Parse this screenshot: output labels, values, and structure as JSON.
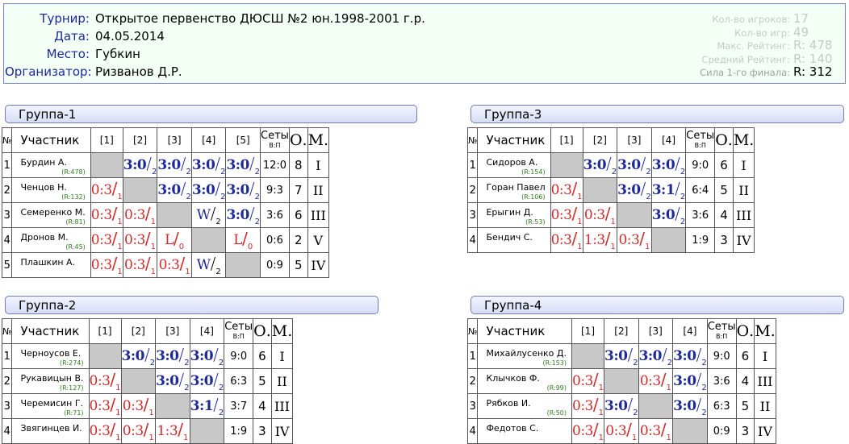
{
  "info": {
    "tournament_label": "Турнир:",
    "tournament": "Открытое первенство ДЮСШ №2 юн.1998-2001 г.р.",
    "date_label": "Дата:",
    "date": "04.05.2014",
    "place_label": "Место:",
    "place": "Губкин",
    "organizer_label": "Организатор:",
    "organizer": "Ризванов Д.Р.",
    "stats": [
      {
        "label": "Кол-во игроков:",
        "value": "17"
      },
      {
        "label": "Кол-во игр:",
        "value": "49"
      },
      {
        "label": "Макс. Рейтинг:",
        "value": "R: 478"
      },
      {
        "label": "Средний Рейтинг:",
        "value": "R: 140"
      },
      {
        "label": "Сила 1-го финала:",
        "value": "R: 312"
      }
    ]
  },
  "headers": {
    "num": "№",
    "name": "Участник",
    "sets": "Сеты",
    "sets_sub": "В:П",
    "points": "О.",
    "place": "М."
  },
  "groups": [
    {
      "title": "Группа-1",
      "cols": [
        "[1]",
        "[2]",
        "[3]",
        "[4]",
        "[5]"
      ],
      "rows": [
        {
          "n": "1",
          "name": "Бурдин А.",
          "rating": "(R:478)",
          "sets": "12:0",
          "pts": "8",
          "place": "I",
          "res": [
            null,
            {
              "s": "3:0",
              "p": "2",
              "t": "win"
            },
            {
              "s": "3:0",
              "p": "2",
              "t": "win"
            },
            {
              "s": "3:0",
              "p": "2",
              "t": "win"
            },
            {
              "s": "3:0",
              "p": "2",
              "t": "win"
            }
          ]
        },
        {
          "n": "2",
          "name": "Ченцов Н.",
          "rating": "(R:132)",
          "sets": "9:3",
          "pts": "7",
          "place": "II",
          "res": [
            {
              "s": "0:3",
              "p": "1",
              "t": "loss"
            },
            null,
            {
              "s": "3:0",
              "p": "2",
              "t": "win"
            },
            {
              "s": "3:0",
              "p": "2",
              "t": "win"
            },
            {
              "s": "3:0",
              "p": "2",
              "t": "win"
            }
          ]
        },
        {
          "n": "3",
          "name": "Семеренко М.",
          "rating": "(R:81)",
          "sets": "3:6",
          "pts": "6",
          "place": "III",
          "res": [
            {
              "s": "0:3",
              "p": "1",
              "t": "loss"
            },
            {
              "s": "0:3",
              "p": "1",
              "t": "loss"
            },
            null,
            {
              "s": "W",
              "p": "2",
              "t": "wo"
            },
            {
              "s": "3:0",
              "p": "2",
              "t": "win"
            }
          ]
        },
        {
          "n": "4",
          "name": "Дронов М.",
          "rating": "(R:45)",
          "sets": "0:6",
          "pts": "2",
          "place": "V",
          "res": [
            {
              "s": "0:3",
              "p": "1",
              "t": "loss"
            },
            {
              "s": "0:3",
              "p": "1",
              "t": "loss"
            },
            {
              "s": "L",
              "p": "0",
              "t": "lo"
            },
            null,
            {
              "s": "L",
              "p": "0",
              "t": "lo"
            }
          ]
        },
        {
          "n": "5",
          "name": "Плашкин А.",
          "rating": "",
          "sets": "0:9",
          "pts": "5",
          "place": "IV",
          "res": [
            {
              "s": "0:3",
              "p": "1",
              "t": "loss"
            },
            {
              "s": "0:3",
              "p": "1",
              "t": "loss"
            },
            {
              "s": "0:3",
              "p": "1",
              "t": "loss"
            },
            {
              "s": "W",
              "p": "2",
              "t": "wo"
            },
            null
          ]
        }
      ]
    },
    {
      "title": "Группа-2",
      "cols": [
        "[1]",
        "[2]",
        "[3]",
        "[4]"
      ],
      "rows": [
        {
          "n": "1",
          "name": "Черноусов Е.",
          "rating": "(R:274)",
          "sets": "9:0",
          "pts": "6",
          "place": "I",
          "res": [
            null,
            {
              "s": "3:0",
              "p": "2",
              "t": "win"
            },
            {
              "s": "3:0",
              "p": "2",
              "t": "win"
            },
            {
              "s": "3:0",
              "p": "2",
              "t": "win"
            }
          ]
        },
        {
          "n": "2",
          "name": "Рукавицын В.",
          "rating": "(R:127)",
          "sets": "6:3",
          "pts": "5",
          "place": "II",
          "res": [
            {
              "s": "0:3",
              "p": "1",
              "t": "loss"
            },
            null,
            {
              "s": "3:0",
              "p": "2",
              "t": "win"
            },
            {
              "s": "3:0",
              "p": "2",
              "t": "win"
            }
          ]
        },
        {
          "n": "3",
          "name": "Черемисин Г.",
          "rating": "(R:71)",
          "sets": "3:7",
          "pts": "4",
          "place": "III",
          "res": [
            {
              "s": "0:3",
              "p": "1",
              "t": "loss"
            },
            {
              "s": "0:3",
              "p": "1",
              "t": "loss"
            },
            null,
            {
              "s": "3:1",
              "p": "2",
              "t": "win"
            }
          ]
        },
        {
          "n": "4",
          "name": "Звягинцев И.",
          "rating": "",
          "sets": "1:9",
          "pts": "3",
          "place": "IV",
          "res": [
            {
              "s": "0:3",
              "p": "1",
              "t": "loss"
            },
            {
              "s": "0:3",
              "p": "1",
              "t": "loss"
            },
            {
              "s": "1:3",
              "p": "1",
              "t": "loss"
            },
            null
          ]
        }
      ]
    },
    {
      "title": "Группа-3",
      "cols": [
        "[1]",
        "[2]",
        "[3]",
        "[4]"
      ],
      "rows": [
        {
          "n": "1",
          "name": "Сидоров А.",
          "rating": "(R:154)",
          "sets": "9:0",
          "pts": "6",
          "place": "I",
          "res": [
            null,
            {
              "s": "3:0",
              "p": "2",
              "t": "win"
            },
            {
              "s": "3:0",
              "p": "2",
              "t": "win"
            },
            {
              "s": "3:0",
              "p": "2",
              "t": "win"
            }
          ]
        },
        {
          "n": "2",
          "name": "Горан Павел",
          "rating": "(R:106)",
          "sets": "6:4",
          "pts": "5",
          "place": "II",
          "res": [
            {
              "s": "0:3",
              "p": "1",
              "t": "loss"
            },
            null,
            {
              "s": "3:0",
              "p": "2",
              "t": "win"
            },
            {
              "s": "3:1",
              "p": "2",
              "t": "win"
            }
          ]
        },
        {
          "n": "3",
          "name": "Ерыгин Д.",
          "rating": "(R:53)",
          "sets": "3:6",
          "pts": "4",
          "place": "III",
          "res": [
            {
              "s": "0:3",
              "p": "1",
              "t": "loss"
            },
            {
              "s": "0:3",
              "p": "1",
              "t": "loss"
            },
            null,
            {
              "s": "3:0",
              "p": "2",
              "t": "win"
            }
          ]
        },
        {
          "n": "4",
          "name": "Бендич С.",
          "rating": "",
          "sets": "1:9",
          "pts": "3",
          "place": "IV",
          "res": [
            {
              "s": "0:3",
              "p": "1",
              "t": "loss"
            },
            {
              "s": "1:3",
              "p": "1",
              "t": "loss"
            },
            {
              "s": "0:3",
              "p": "1",
              "t": "loss"
            },
            null
          ]
        }
      ]
    },
    {
      "title": "Группа-4",
      "cols": [
        "[1]",
        "[2]",
        "[3]",
        "[4]"
      ],
      "rows": [
        {
          "n": "1",
          "name": "Михайлусенко Д.",
          "rating": "(R:153)",
          "sets": "9:0",
          "pts": "6",
          "place": "I",
          "res": [
            null,
            {
              "s": "3:0",
              "p": "2",
              "t": "win"
            },
            {
              "s": "3:0",
              "p": "2",
              "t": "win"
            },
            {
              "s": "3:0",
              "p": "2",
              "t": "win"
            }
          ]
        },
        {
          "n": "2",
          "name": "Клычков Ф.",
          "rating": "(R:99)",
          "sets": "3:6",
          "pts": "4",
          "place": "III",
          "res": [
            {
              "s": "0:3",
              "p": "1",
              "t": "loss"
            },
            null,
            {
              "s": "0:3",
              "p": "1",
              "t": "loss"
            },
            {
              "s": "3:0",
              "p": "2",
              "t": "win"
            }
          ]
        },
        {
          "n": "3",
          "name": "Рябков И.",
          "rating": "(R:50)",
          "sets": "6:3",
          "pts": "5",
          "place": "II",
          "res": [
            {
              "s": "0:3",
              "p": "1",
              "t": "loss"
            },
            {
              "s": "3:0",
              "p": "2",
              "t": "win"
            },
            null,
            {
              "s": "3:0",
              "p": "2",
              "t": "win"
            }
          ]
        },
        {
          "n": "4",
          "name": "Федотов С.",
          "rating": "",
          "sets": "0:9",
          "pts": "3",
          "place": "IV",
          "res": [
            {
              "s": "0:3",
              "p": "1",
              "t": "loss"
            },
            {
              "s": "0:3",
              "p": "1",
              "t": "loss"
            },
            {
              "s": "0:3",
              "p": "1",
              "t": "loss"
            },
            null
          ]
        }
      ]
    }
  ]
}
